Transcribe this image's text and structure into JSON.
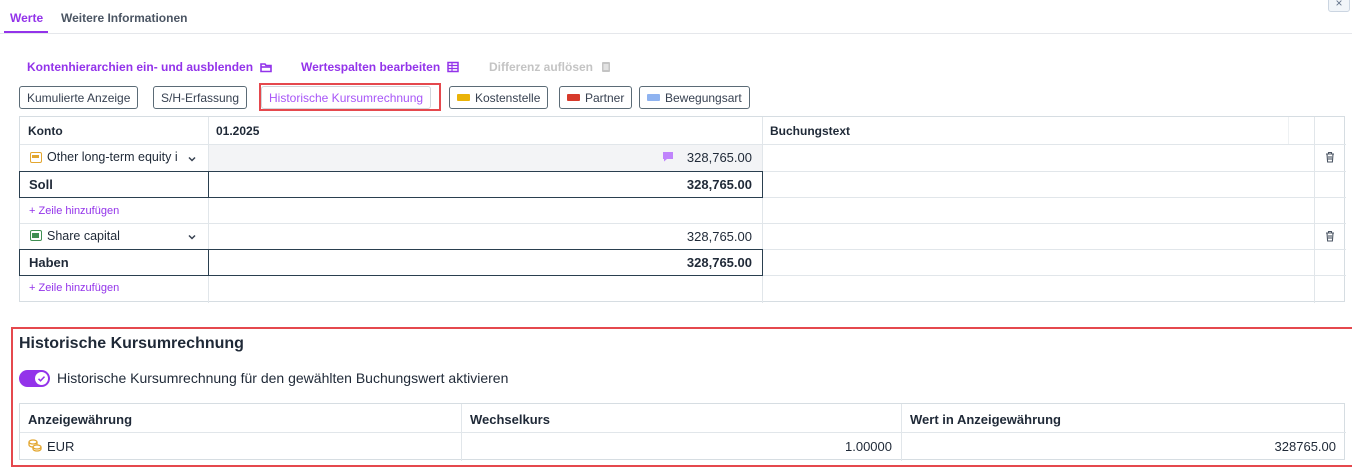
{
  "tabs": [
    {
      "label": "Werte",
      "active": true
    },
    {
      "label": "Weitere Informationen",
      "active": false
    }
  ],
  "close_label": "×",
  "actions": {
    "toggle_hierarchies": {
      "label": "Kontenhierarchien ein- und ausblenden",
      "icon": "folder-icon"
    },
    "edit_columns": {
      "label": "Wertespalten bearbeiten",
      "icon": "columns-icon"
    },
    "resolve_difference": {
      "label": "Differenz auflösen",
      "icon": "document-icon",
      "disabled": true
    }
  },
  "chips": [
    {
      "label": "Kumulierte Anzeige",
      "swatch": null
    },
    {
      "label": "S/H-Erfassung",
      "swatch": null
    },
    {
      "label": "Historische Kursumrechnung",
      "swatch": null,
      "active": true
    },
    {
      "label": "Kostenstelle",
      "swatch": "#eab308"
    },
    {
      "label": "Partner",
      "swatch": "#d73a2b"
    },
    {
      "label": "Bewegungsart",
      "swatch": "#8fb3f0"
    }
  ],
  "table": {
    "headers": {
      "account": "Konto",
      "period": "01.2025",
      "text": "Buchungstext"
    },
    "soll": {
      "account": "Other long-term equity i",
      "account_icon_color": "#e3a62f",
      "amount": "328,765.00",
      "total_label": "Soll",
      "total_amount": "328,765.00"
    },
    "haben": {
      "account": "Share capital",
      "account_icon_color": "#3f8f52",
      "amount": "328,765.00",
      "total_label": "Haben",
      "total_amount": "328,765.00"
    },
    "add_row": "+ Zeile hinzufügen"
  },
  "historic": {
    "title": "Historische Kursumrechnung",
    "toggle_label": "Historische Kursumrechnung für den gewählten Buchungswert aktivieren",
    "toggle_on": true,
    "headers": {
      "currency": "Anzeigewährung",
      "rate": "Wechselkurs",
      "value": "Wert in Anzeigewährung"
    },
    "row": {
      "currency": "EUR",
      "rate": "1.00000",
      "value": "328765.00"
    }
  },
  "colors": {
    "accent": "#9333ea",
    "highlight": "#e5484d",
    "border_dark": "#2a3f4f"
  }
}
